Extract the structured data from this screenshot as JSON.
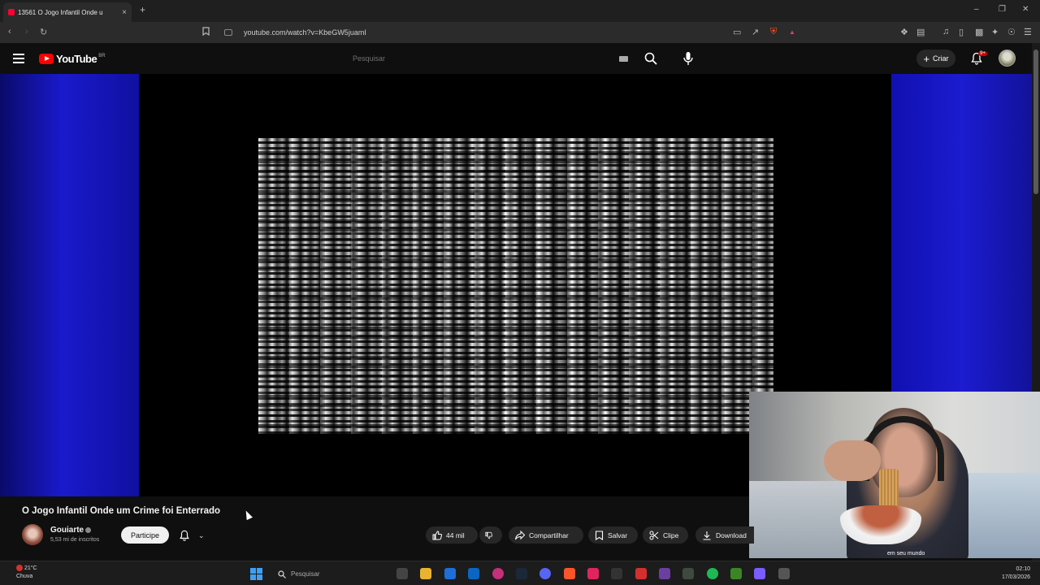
{
  "browser": {
    "tab_title": "13561 O Jogo Infantil Onde u",
    "tab_close": "×",
    "new_tab": "+",
    "url": "youtube.com/watch?v=KbeGW5juamI",
    "window_controls": [
      "–",
      "❐",
      "✕"
    ]
  },
  "youtube": {
    "logo_text": "YouTube",
    "logo_country": "BR",
    "search_placeholder": "Pesquisar",
    "create_label": "Criar",
    "create_plus": "+",
    "notif_count": "9+"
  },
  "video": {
    "title": "O Jogo Infantil Onde um Crime foi Enterrado",
    "webcam_caption": "em seu mundo"
  },
  "channel": {
    "name": "Gouiarte",
    "subscribers": "5,53 mi de inscritos",
    "join_label": "Participe",
    "chevron": "⌄"
  },
  "actions": {
    "like_count": "44 mil",
    "share_label": "Compartilhar",
    "save_label": "Salvar",
    "clip_label": "Clipe",
    "download_label": "Download"
  },
  "taskbar": {
    "temperature": "21°C",
    "weather_label": "Chuva",
    "search_placeholder": "Pesquisar",
    "time": "02:10",
    "date": "17/03/2026"
  },
  "colors": {
    "youtube_red": "#ff0000",
    "background": "#0f0f0f",
    "video_blue": "#1a1acc",
    "windows_accent": "#3ea0f5"
  }
}
